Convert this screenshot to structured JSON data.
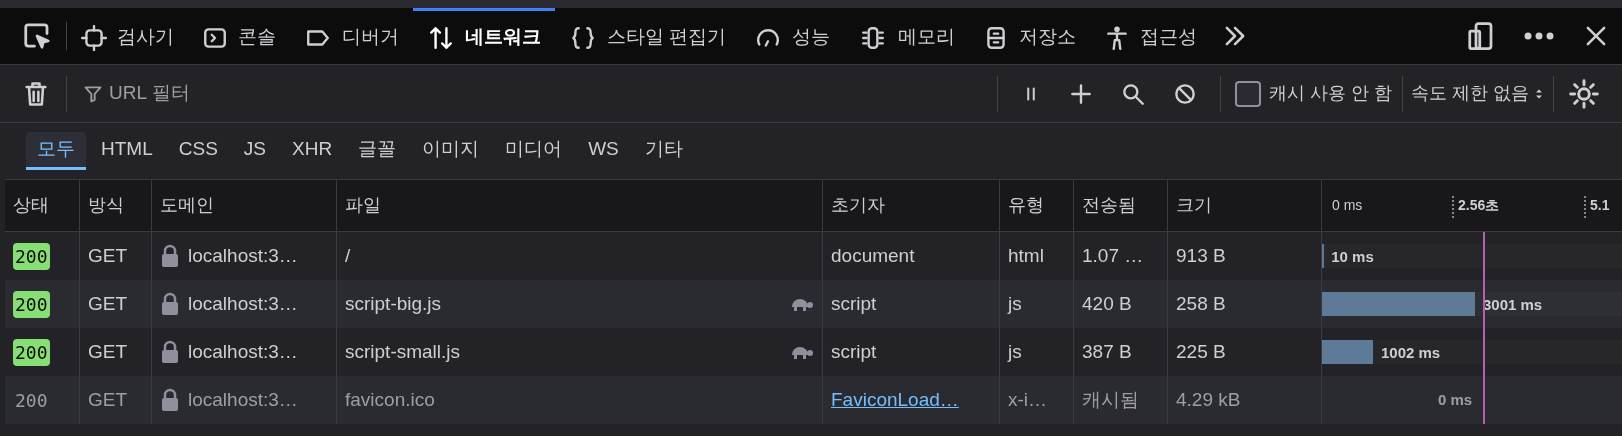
{
  "tabs": [
    {
      "label": "검사기",
      "selected": false
    },
    {
      "label": "콘솔",
      "selected": false
    },
    {
      "label": "디버거",
      "selected": false
    },
    {
      "label": "네트워크",
      "selected": true
    },
    {
      "label": "스타일 편집기",
      "selected": false
    },
    {
      "label": "성능",
      "selected": false
    },
    {
      "label": "메모리",
      "selected": false
    },
    {
      "label": "저장소",
      "selected": false
    },
    {
      "label": "접근성",
      "selected": false
    }
  ],
  "toolbar": {
    "filter": {
      "placeholder": "URL 필터"
    },
    "disable_cache": {
      "label": "캐시 사용 안 함",
      "checked": false
    },
    "throttling": "속도 제한 없음"
  },
  "type_filters": [
    {
      "label": "모두",
      "selected": true
    },
    {
      "label": "HTML",
      "selected": false
    },
    {
      "label": "CSS",
      "selected": false
    },
    {
      "label": "JS",
      "selected": false
    },
    {
      "label": "XHR",
      "selected": false
    },
    {
      "label": "글꼴",
      "selected": false
    },
    {
      "label": "이미지",
      "selected": false
    },
    {
      "label": "미디어",
      "selected": false
    },
    {
      "label": "WS",
      "selected": false
    },
    {
      "label": "기타",
      "selected": false
    }
  ],
  "table": {
    "columns": [
      "상태",
      "방식",
      "도메인",
      "파일",
      "초기자",
      "유형",
      "전송됨",
      "크기"
    ],
    "timeline_ticks": [
      "0 ms",
      "2.56초",
      "5.1"
    ],
    "rows": [
      {
        "status": "200",
        "method": "GET",
        "domain": "localhost:3…",
        "file": "/",
        "throttled": false,
        "initiator": "document",
        "initiator_link": false,
        "type": "html",
        "transferred": "1.07 …",
        "size": "913 B",
        "cached": false,
        "level": 0.004,
        "timing": "10 ms"
      },
      {
        "status": "200",
        "method": "GET",
        "domain": "localhost:3…",
        "file": "script-big.js",
        "throttled": true,
        "initiator": "script",
        "initiator_link": false,
        "type": "js",
        "transferred": "420 B",
        "size": "258 B",
        "cached": false,
        "level": 0.51,
        "timing": "3001 ms"
      },
      {
        "status": "200",
        "method": "GET",
        "domain": "localhost:3…",
        "file": "script-small.js",
        "throttled": true,
        "initiator": "script",
        "initiator_link": false,
        "type": "js",
        "transferred": "387 B",
        "size": "225 B",
        "cached": false,
        "level": 0.17,
        "timing": "1002 ms"
      },
      {
        "status": "200",
        "method": "GET",
        "domain": "localhost:3…",
        "file": "favicon.ico",
        "throttled": false,
        "initiator": "FaviconLoad…",
        "initiator_link": true,
        "type": "x-i…",
        "transferred": "캐시됨",
        "size": "4.29 kB",
        "cached": true,
        "timing": "0 ms"
      }
    ]
  }
}
